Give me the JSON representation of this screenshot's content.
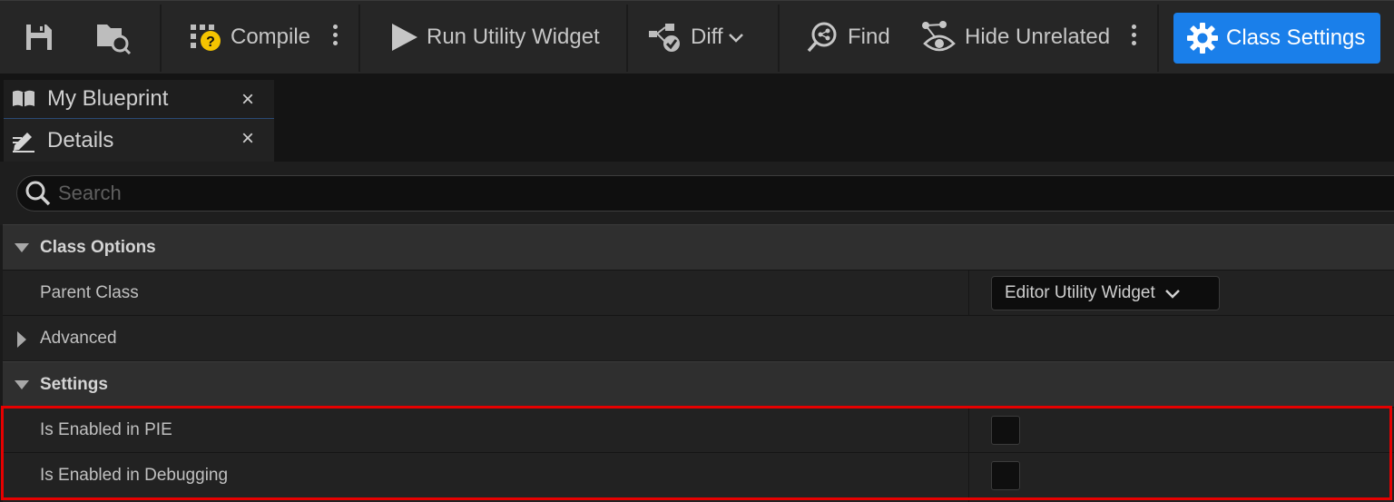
{
  "toolbar": {
    "compile_label": "Compile",
    "run_label": "Run Utility Widget",
    "diff_label": "Diff",
    "find_label": "Find",
    "hide_unrelated_label": "Hide Unrelated",
    "class_settings_label": "Class Settings"
  },
  "tabs": [
    {
      "label": "My Blueprint",
      "icon": "book-icon",
      "close": "×"
    },
    {
      "label": "Details",
      "icon": "pencil-icon",
      "close": "×"
    }
  ],
  "search": {
    "placeholder": "Search",
    "value": ""
  },
  "details": {
    "class_options": {
      "label": "Class Options",
      "parent_class_label": "Parent Class",
      "parent_class_value": "Editor Utility Widget",
      "advanced_label": "Advanced"
    },
    "settings": {
      "label": "Settings",
      "enabled_in_pie_label": "Is Enabled in PIE",
      "enabled_in_pie_checked": false,
      "enabled_in_debugging_label": "Is Enabled in Debugging",
      "enabled_in_debugging_checked": false
    }
  },
  "colors": {
    "accent": "#1a7fea",
    "highlight": "#e60000",
    "compile_badge": "#f5c400"
  }
}
